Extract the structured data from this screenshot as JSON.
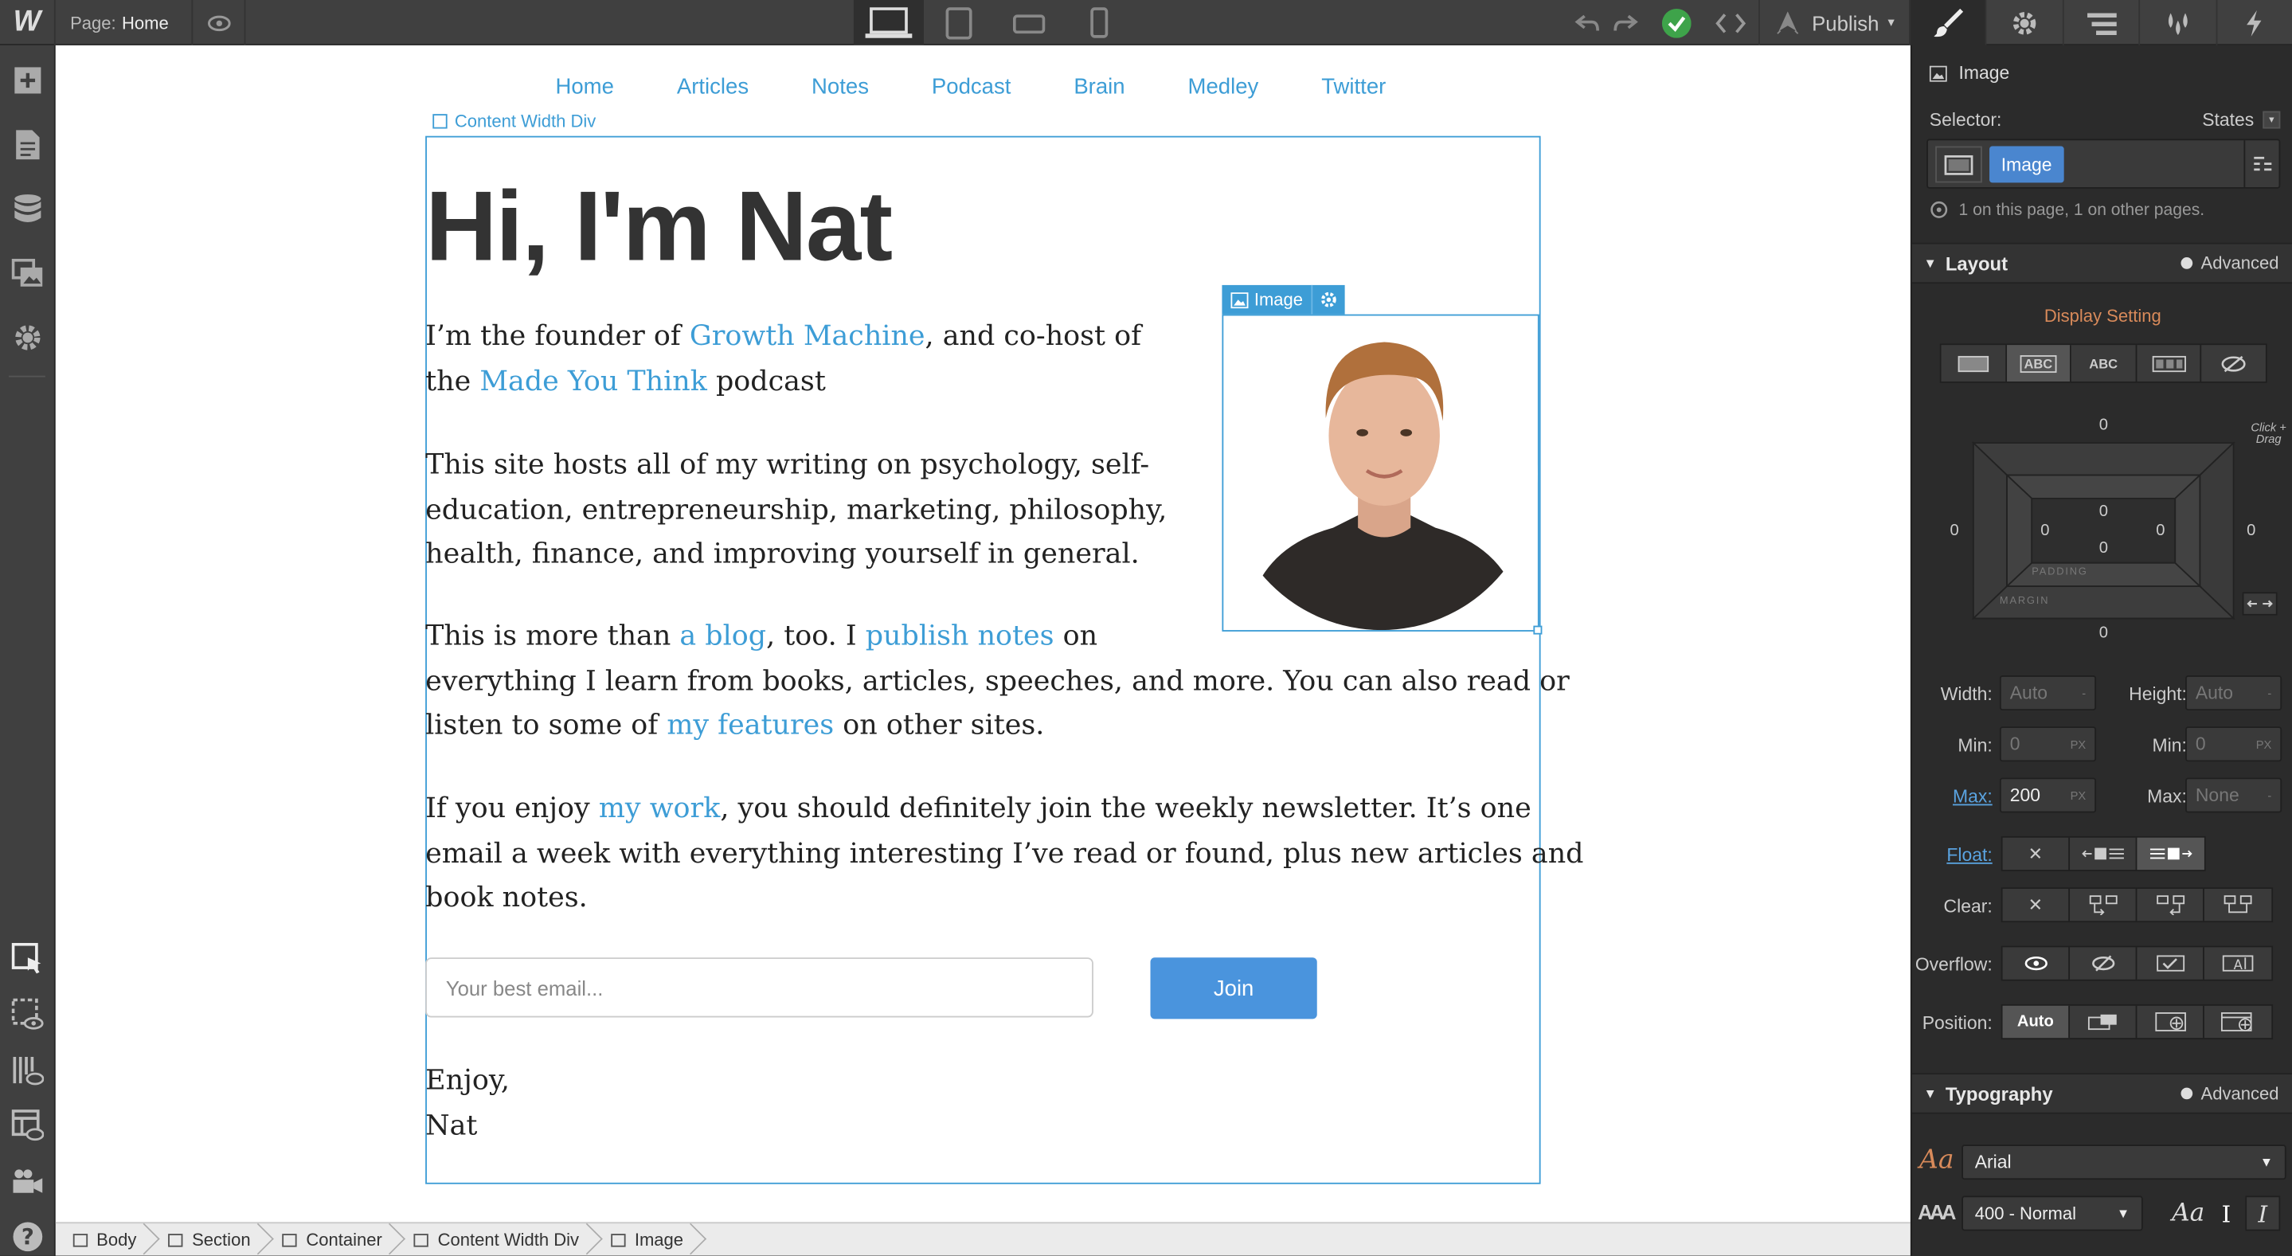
{
  "topbar": {
    "logo": "W",
    "page_label": "Page:",
    "page_name": "Home",
    "publish_label": "Publish"
  },
  "canvas": {
    "nav": [
      "Home",
      "Articles",
      "Notes",
      "Podcast",
      "Brain",
      "Medley",
      "Twitter"
    ],
    "content_width_label": "Content Width Div",
    "image_tag_label": "Image",
    "hero_title": "Hi, I'm Nat",
    "p1": {
      "t1": "I’m the founder of ",
      "link1": "Growth Machine",
      "t2": ", and co-host of",
      "t3": "the ",
      "link2": "Made You Think",
      "t4": " podcast"
    },
    "p2": [
      "This site hosts all of my writing on psychology, self-",
      "education, entrepreneurship, marketing, philosophy,",
      "health, finance, and improving yourself in general."
    ],
    "p3": {
      "t1": "This is more than ",
      "link1": "a blog",
      "t2": ", too. I ",
      "link2": "publish notes",
      "t3": " on",
      "line2": "everything I learn from books, articles, speeches, and more. You can also read or",
      "t4": "listen to some of ",
      "link3": "my features",
      "t5": " on other sites."
    },
    "p4": {
      "t1": "If you enjoy ",
      "link1": "my work",
      "t2": ", you should definitely join the weekly newsletter. It’s one",
      "line2": "email a week with everything interesting I’ve read or found, plus new articles and",
      "line3": "book notes."
    },
    "email_placeholder": "Your best email...",
    "join_label": "Join",
    "signoff": [
      "Enjoy,",
      "Nat"
    ]
  },
  "breadcrumbs": [
    "Body",
    "Section",
    "Container",
    "Content Width Div",
    "Image"
  ],
  "panel": {
    "element_label": "Image",
    "selector_label": "Selector:",
    "states_label": "States",
    "selector_chip": "Image",
    "selector_info": "1 on this page, 1 on other pages.",
    "layout_title": "Layout",
    "advanced_label": "Advanced",
    "display_setting": "Display Setting",
    "display_options": [
      "",
      "ABC",
      "ABC",
      "",
      ""
    ],
    "spacing": {
      "margin_top": "0",
      "margin_bottom": "0",
      "margin_left": "0",
      "margin_right": "0",
      "padding_top": "0",
      "padding_bottom": "0",
      "padding_left": "0",
      "padding_right": "0",
      "padding_label": "PADDING",
      "margin_label": "MARGIN"
    },
    "click_drag": "Click + Drag",
    "width_label": "Width:",
    "width_value": "Auto",
    "height_label": "Height:",
    "height_value": "Auto",
    "min_label": "Min:",
    "min_w": "0",
    "min_h": "0",
    "unit": "PX",
    "max_label": "Max:",
    "max_w": "200",
    "max_h": "None",
    "float_label": "Float:",
    "clear_label": "Clear:",
    "overflow_label": "Overflow:",
    "position_label": "Position:",
    "position_auto": "Auto",
    "typography_title": "Typography",
    "font_family": "Arial",
    "font_weight": "400 - Normal"
  }
}
